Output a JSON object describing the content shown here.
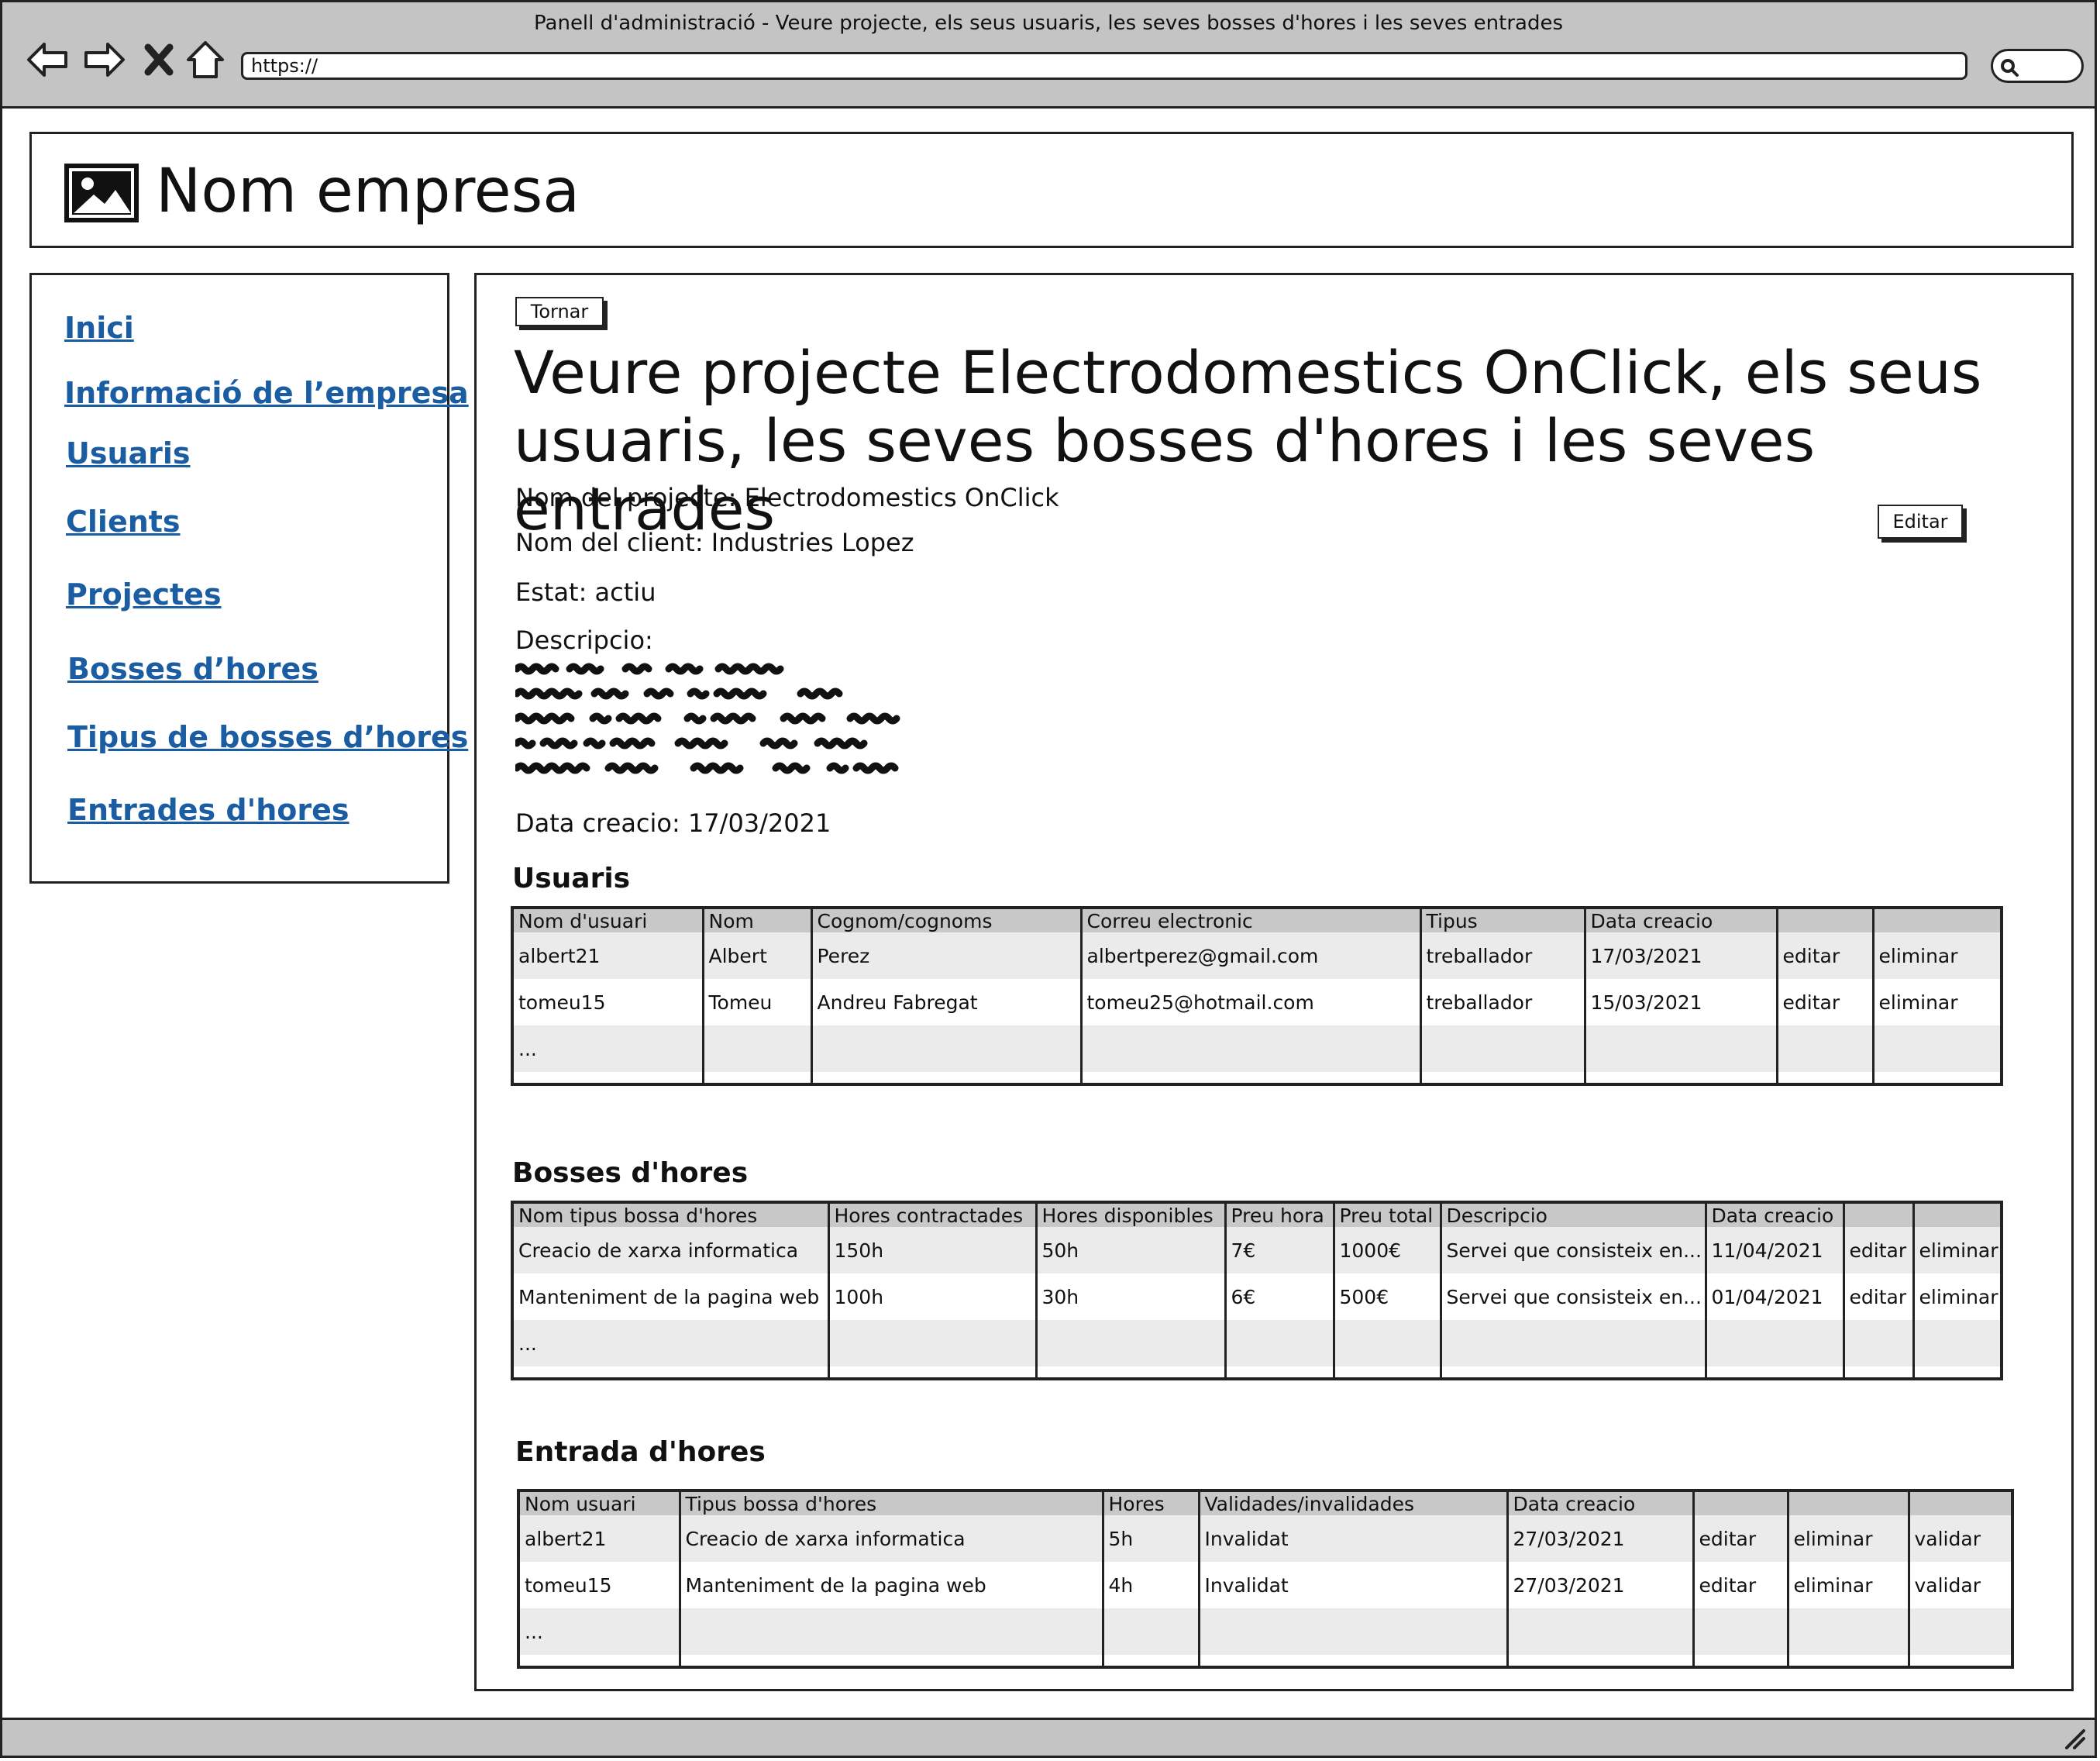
{
  "window": {
    "title": "Panell d'administració - Veure projecte, els seus usuaris, les seves bosses d'hores i les seves entrades",
    "url": "https://"
  },
  "header": {
    "company_name": "Nom empresa"
  },
  "sidebar": {
    "items": [
      {
        "label": "Inici"
      },
      {
        "label": "Informació de l’empresa"
      },
      {
        "label": "Usuaris"
      },
      {
        "label": "Clients"
      },
      {
        "label": "Projectes"
      },
      {
        "label": "Bosses d’hores"
      },
      {
        "label": "Tipus de bosses d’hores"
      },
      {
        "label": "Entrades d'hores"
      }
    ]
  },
  "main": {
    "back_button": "Tornar",
    "edit_button": "Editar",
    "title": "Veure projecte Electrodomestics OnClick, els seus usuaris, les seves bosses d'hores i les seves entrades",
    "project_name": "Nom del projecte: Electrodomestics OnClick",
    "client_name": "Nom del client: Industries Lopez",
    "status": "Estat: actiu",
    "description_label": "Descripcio:",
    "creation_date": "Data creacio: 17/03/2021"
  },
  "users_section": {
    "title": "Usuaris",
    "headers": [
      "Nom d'usuari",
      "Nom",
      "Cognom/cognoms",
      "Correu electronic",
      "Tipus",
      "Data creacio",
      "",
      ""
    ],
    "rows": [
      [
        "albert21",
        "Albert",
        "Perez",
        "albertperez@gmail.com",
        "treballador",
        "17/03/2021",
        "editar",
        "eliminar"
      ],
      [
        "tomeu15",
        "Tomeu",
        "Andreu Fabregat",
        "tomeu25@hotmail.com",
        "treballador",
        "15/03/2021",
        "editar",
        "eliminar"
      ]
    ],
    "more": "..."
  },
  "bags_section": {
    "title": "Bosses d'hores",
    "headers": [
      "Nom tipus bossa d'hores",
      "Hores contractades",
      "Hores disponibles",
      "Preu hora",
      "Preu total",
      "Descripcio",
      "Data creacio",
      "",
      ""
    ],
    "rows": [
      [
        "Creacio de xarxa informatica",
        "150h",
        "50h",
        "7€",
        "1000€",
        "Servei que consisteix en...",
        "11/04/2021",
        "editar",
        "eliminar"
      ],
      [
        "Manteniment de la pagina web",
        "100h",
        "30h",
        "6€",
        "500€",
        "Servei que consisteix en...",
        "01/04/2021",
        "editar",
        "eliminar"
      ]
    ],
    "more": "..."
  },
  "entries_section": {
    "title": "Entrada d'hores",
    "headers": [
      "Nom usuari",
      "Tipus bossa d'hores",
      "Hores",
      "Validades/invalidades",
      "Data creacio",
      "",
      "",
      ""
    ],
    "rows": [
      [
        "albert21",
        "Creacio de xarxa informatica",
        "5h",
        "Invalidat",
        "27/03/2021",
        "editar",
        "eliminar",
        "validar"
      ],
      [
        "tomeu15",
        "Manteniment de la pagina web",
        "4h",
        "Invalidat",
        "27/03/2021",
        "editar",
        "eliminar",
        "validar"
      ]
    ],
    "more": "..."
  }
}
